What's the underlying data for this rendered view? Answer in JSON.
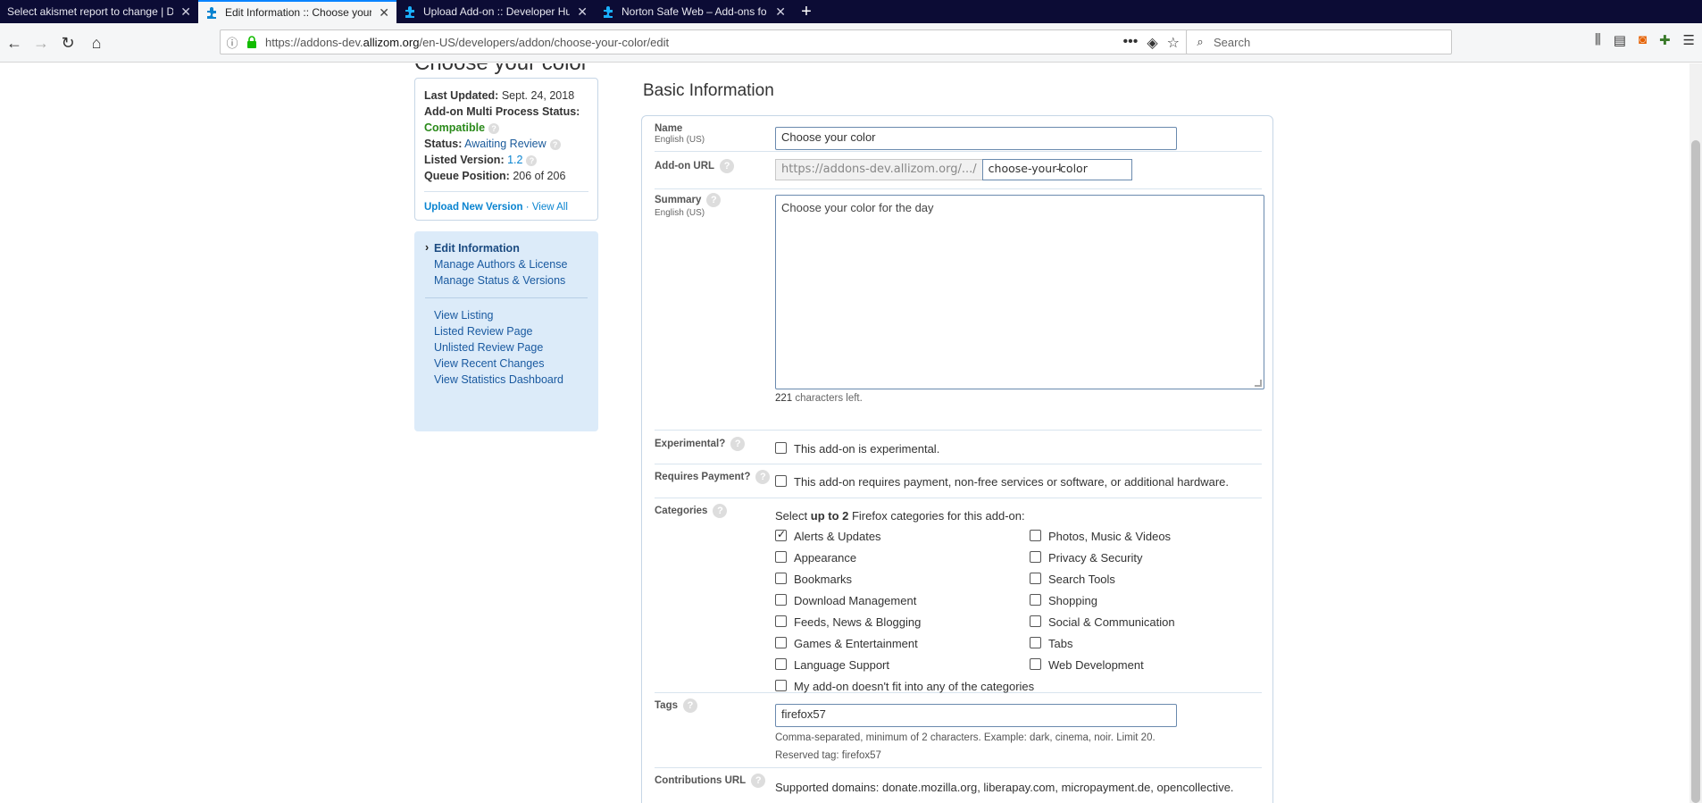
{
  "browser": {
    "tabs": [
      {
        "title": "Select akismet report to change | D",
        "active": false
      },
      {
        "title": "Edit Information :: Choose your",
        "active": true
      },
      {
        "title": "Upload Add-on :: Developer Hu",
        "active": false
      },
      {
        "title": "Norton Safe Web – Add-ons fo",
        "active": false
      }
    ],
    "new_tab_label": "+",
    "url_prefix": "https://addons-dev.",
    "url_domain": "allizom.org",
    "url_path": "/en-US/developers/addon/choose-your-color/edit",
    "search_placeholder": "Search",
    "page_actions": [
      "more-icon",
      "pocket-icon",
      "bookmark-star-icon"
    ],
    "toolbar_icons": [
      "library-icon",
      "sidebar-icon",
      "screenshot-icon",
      "extensions-icon",
      "menu-icon"
    ]
  },
  "addon_heading": "Choose your color",
  "status_panel": {
    "last_updated_label": "Last Updated:",
    "last_updated_value": "Sept. 24, 2018",
    "multiprocess_label": "Add-on Multi Process Status:",
    "multiprocess_value": "Compatible",
    "status_label": "Status:",
    "status_value": "Awaiting Review",
    "listed_version_label": "Listed Version:",
    "listed_version_value": "1.2",
    "queue_label": "Queue Position:",
    "queue_value": "206 of 206",
    "upload_link": "Upload New Version",
    "separator": "·",
    "view_all_link": "View All"
  },
  "nav": {
    "primary": [
      "Edit Information",
      "Manage Authors & License",
      "Manage Status & Versions"
    ],
    "secondary": [
      "View Listing",
      "Listed Review Page",
      "Unlisted Review Page",
      "View Recent Changes",
      "View Statistics Dashboard"
    ]
  },
  "section_title": "Basic Information",
  "form": {
    "name_label": "Name",
    "name_locale": "English (US)",
    "name_value": "Choose your color",
    "url_label": "Add-on URL",
    "url_prefix": "https://addons-dev.allizom.org/.../",
    "url_slug": "choose-your-color",
    "summary_label": "Summary",
    "summary_locale": "English (US)",
    "summary_value": "Choose your color for the day",
    "chars_left_count": "221",
    "chars_left_text": "characters left.",
    "experimental_label": "Experimental?",
    "experimental_text": "This add-on is experimental.",
    "payment_label": "Requires Payment?",
    "payment_text": "This add-on requires payment, non-free services or software, or additional hardware.",
    "categories_label": "Categories",
    "categories_intro_a": "Select ",
    "categories_intro_b": "up to 2",
    "categories_intro_c": " Firefox categories for this add-on:",
    "categories_left": [
      {
        "label": "Alerts & Updates",
        "checked": true
      },
      {
        "label": "Appearance",
        "checked": false
      },
      {
        "label": "Bookmarks",
        "checked": false
      },
      {
        "label": "Download Management",
        "checked": false
      },
      {
        "label": "Feeds, News & Blogging",
        "checked": false
      },
      {
        "label": "Games & Entertainment",
        "checked": false
      },
      {
        "label": "Language Support",
        "checked": false
      }
    ],
    "categories_right": [
      {
        "label": "Photos, Music & Videos",
        "checked": false
      },
      {
        "label": "Privacy & Security",
        "checked": false
      },
      {
        "label": "Search Tools",
        "checked": false
      },
      {
        "label": "Shopping",
        "checked": false
      },
      {
        "label": "Social & Communication",
        "checked": false
      },
      {
        "label": "Tabs",
        "checked": false
      },
      {
        "label": "Web Development",
        "checked": false
      }
    ],
    "category_other": "My add-on doesn't fit into any of the categories",
    "tags_label": "Tags",
    "tags_value": "firefox57",
    "tags_hint": "Comma-separated, minimum of 2 characters. Example: dark, cinema, noir. Limit 20.",
    "tags_reserved": "Reserved tag: firefox57",
    "contrib_label": "Contributions URL",
    "contrib_domains": "Supported domains: donate.mozilla.org, liberapay.com, micropayment.de, opencollective."
  }
}
